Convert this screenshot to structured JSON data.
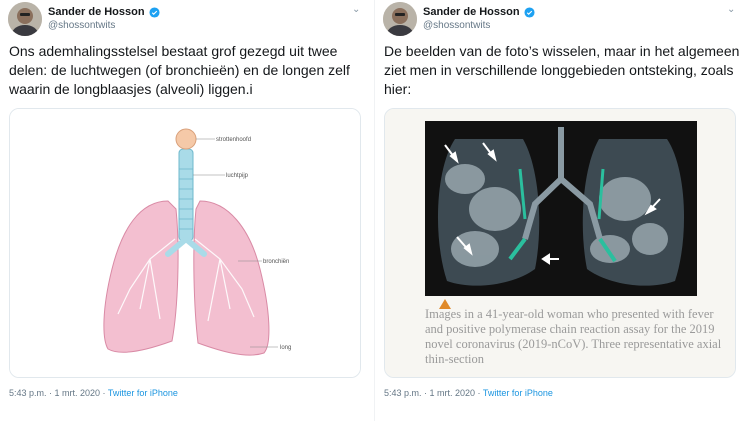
{
  "tweets": [
    {
      "author_name": "Sander de Hosson",
      "author_handle": "@shossontwits",
      "text": "Ons ademhalingsstelsel bestaat grof gezegd uit twee delen: de luchtwegen (of bronchieën) en de longen zelf waarin de longblaasjes (alveoli) liggen.i",
      "image_labels": {
        "strottenhoofd": "strottenhoofd",
        "luchtpijp": "luchtpijp",
        "bronchien": "bronchiën",
        "long": "long"
      },
      "time": "5:43 p.m. · 1 mrt. 2020",
      "via": "Twitter for iPhone"
    },
    {
      "author_name": "Sander de Hosson",
      "author_handle": "@shossontwits",
      "text": "De beelden van de foto’s wisselen, maar in het algemeen ziet men in verschillende longgebieden ontsteking, zoals hier:",
      "image_caption": "Images in a 41-year-old woman who presented with fever and positive polymerase chain reaction assay for the 2019 novel coronavirus (2019-nCoV). Three representative axial thin-section",
      "time": "5:43 p.m. · 1 mrt. 2020",
      "via": "Twitter for iPhone"
    }
  ],
  "colors": {
    "link": "#1b95e0",
    "secondary_text": "#657786",
    "verified": "#1da1f2",
    "lung_pink": "#f1b6c8",
    "trachea_blue": "#a9dbe8"
  },
  "icons": [
    "verified-badge-icon",
    "chevron-down-icon"
  ]
}
